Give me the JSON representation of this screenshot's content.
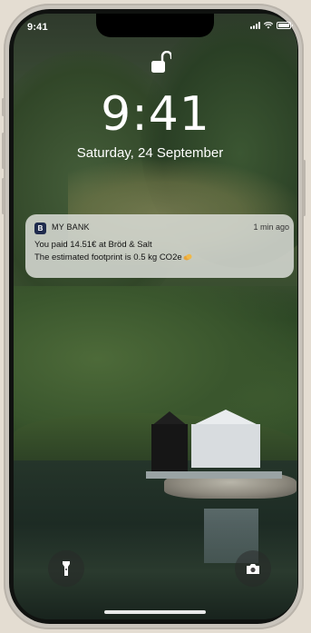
{
  "status_bar": {
    "time": "9:41"
  },
  "lock_screen": {
    "time": "9:41",
    "date": "Saturday, 24 September"
  },
  "notification": {
    "app_icon_letter": "B",
    "app_name": "MY BANK",
    "time": "1 min ago",
    "line1": "You paid 14.51€ at Bröd & Salt",
    "line2": "The estimated footprint is 0.5 kg CO2e"
  },
  "icons": {
    "lock": "unlocked-padlock-icon",
    "flashlight": "flashlight-icon",
    "camera": "camera-icon",
    "footprint": "cloud-emoji-icon"
  },
  "colors": {
    "notification_bg": "#dadcd6",
    "app_icon_bg": "#1f2b4d",
    "frame": "#c9c4bc"
  }
}
